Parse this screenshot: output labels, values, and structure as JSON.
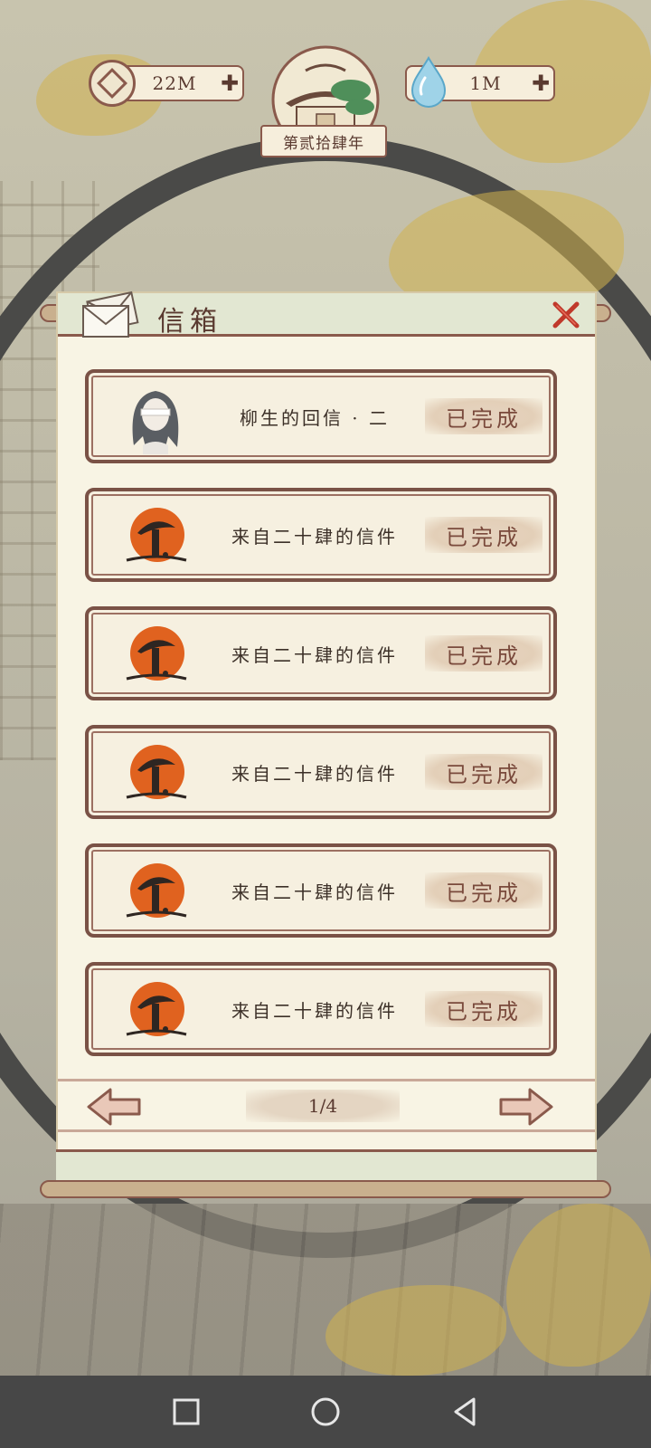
{
  "hud": {
    "coins": "22M",
    "water": "1M",
    "year_label": "第贰拾肆年"
  },
  "mailbox": {
    "title": "信箱",
    "items": [
      {
        "title": "柳生的回信 · 二",
        "status": "已完成",
        "avatar": "portrait-avatar"
      },
      {
        "title": "来自二十肆的信件",
        "status": "已完成",
        "avatar": "mushroom-seal-icon"
      },
      {
        "title": "来自二十肆的信件",
        "status": "已完成",
        "avatar": "mushroom-seal-icon"
      },
      {
        "title": "来自二十肆的信件",
        "status": "已完成",
        "avatar": "mushroom-seal-icon"
      },
      {
        "title": "来自二十肆的信件",
        "status": "已完成",
        "avatar": "mushroom-seal-icon"
      },
      {
        "title": "来自二十肆的信件",
        "status": "已完成",
        "avatar": "mushroom-seal-icon"
      }
    ],
    "page": "1/4"
  },
  "colors": {
    "accent_border": "#7a5246",
    "panel_bg": "#f8f4e4",
    "header_bg": "#e2e7d2",
    "seal_orange": "#e0621f",
    "close_red": "#c0392b"
  }
}
